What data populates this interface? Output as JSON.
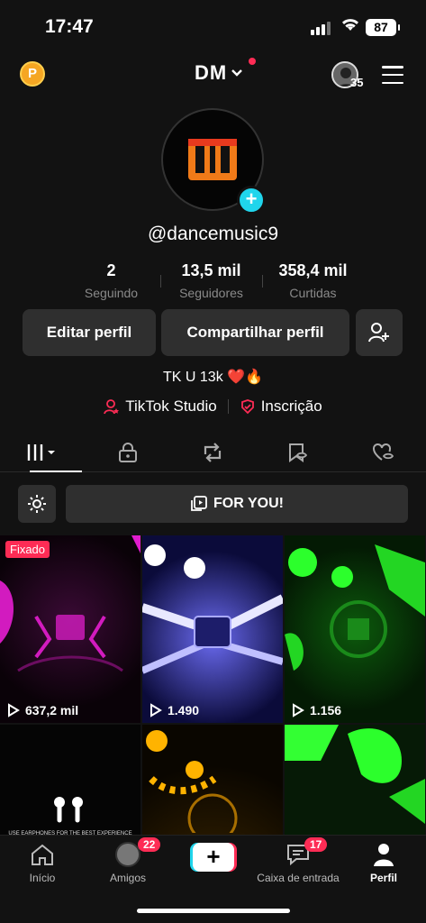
{
  "status_bar": {
    "time": "17:47",
    "battery": "87"
  },
  "header": {
    "coin_label": "P",
    "account_name": "DM",
    "avatar_count": "35"
  },
  "profile": {
    "username": "@dancemusic9",
    "stats": [
      {
        "value": "2",
        "label": "Seguindo"
      },
      {
        "value": "13,5 mil",
        "label": "Seguidores"
      },
      {
        "value": "358,4 mil",
        "label": "Curtidas"
      }
    ],
    "buttons": {
      "edit": "Editar perfil",
      "share": "Compartilhar perfil"
    },
    "bio": "TK U 13k ❤️🔥",
    "links": {
      "studio": "TikTok Studio",
      "subscription": "Inscrição"
    }
  },
  "tabs": [
    "videos",
    "private",
    "reposts",
    "favorites",
    "liked"
  ],
  "playlist": {
    "label": "FOR YOU!"
  },
  "videos": [
    {
      "views": "637,2 mil",
      "pinned_label": "Fixado",
      "theme": "#c21bb0"
    },
    {
      "views": "1.490",
      "theme": "#3a3ad8"
    },
    {
      "views": "1.156",
      "theme": "#1fc41f"
    },
    {
      "views": "",
      "theme": "#0a0a0a",
      "caption": "USE EARPHONES FOR THE BEST EXPERIENCE"
    },
    {
      "views": "",
      "theme": "#e0a000"
    },
    {
      "views": "",
      "theme": "#1bd61b"
    }
  ],
  "nav": {
    "home": "Início",
    "friends": "Amigos",
    "friends_badge": "22",
    "inbox": "Caixa de entrada",
    "inbox_badge": "17",
    "profile": "Perfil"
  },
  "colors": {
    "accent": "#fe2c55",
    "cyan": "#20d5ec",
    "background": "#121212"
  }
}
